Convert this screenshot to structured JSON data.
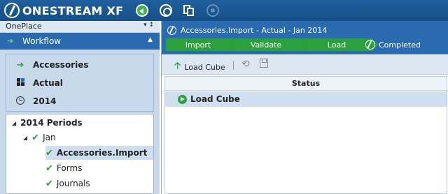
{
  "app": {
    "logo_text": "ONESTREAM XF"
  },
  "left_panel": {
    "title": "OnePlace",
    "pin_icons": "▾ ↕",
    "workflow_label": "Workflow",
    "pov": [
      {
        "label": "Accessories",
        "icon": "green-arrow-icon"
      },
      {
        "label": "Actual",
        "icon": "cube-icon"
      },
      {
        "label": "2014",
        "icon": "clock-icon"
      }
    ],
    "tree": {
      "root": "2014 Periods",
      "period": "Jan",
      "children": [
        "Accessories.Import",
        "Forms",
        "Journals"
      ],
      "selected": "Accessories.Import"
    }
  },
  "workflow": {
    "title": "Accessories.Import  -  Actual  -  Jan 2014",
    "steps": [
      "Import",
      "Validate",
      "Load"
    ],
    "completed_label": "Completed",
    "step_color": "#2aa13c"
  },
  "toolbar": {
    "load_cube_label": "Load Cube"
  },
  "grid": {
    "column_header": "Status",
    "rows": [
      "Load Cube"
    ]
  },
  "colors": {
    "header_blue": "#2a6bb0",
    "panel_bg": "#c7d8ea",
    "selection": "#cfdff0"
  }
}
